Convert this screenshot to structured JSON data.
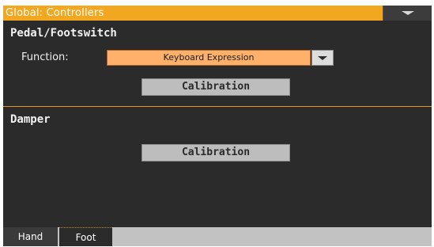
{
  "header": {
    "title": "Global: Controllers",
    "menu_icon": "chevron-down-icon"
  },
  "pedal_section": {
    "title": "Pedal/Footswitch",
    "function_label": "Function:",
    "function_value": "Keyboard Expression",
    "calibration_label": "Calibration"
  },
  "damper_section": {
    "title": "Damper",
    "calibration_label": "Calibration"
  },
  "tabs": [
    {
      "label": "Hand",
      "selected": false
    },
    {
      "label": "Foot",
      "selected": true
    }
  ],
  "colors": {
    "accent": "#f1a71f",
    "background": "#2b2b2b",
    "selected_field": "#ffb16c",
    "button": "#bdbdbd"
  }
}
